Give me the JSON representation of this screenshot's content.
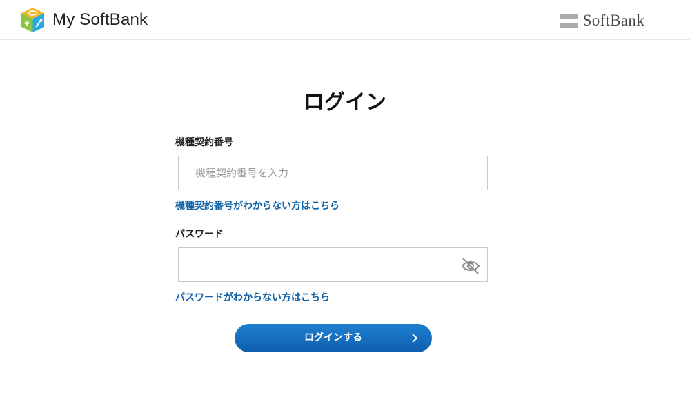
{
  "header": {
    "app_name": "My SoftBank",
    "corporate_logo_text": "SoftBank"
  },
  "login": {
    "title": "ログイン",
    "contract_number": {
      "label": "機種契約番号",
      "placeholder": "機種契約番号を入力",
      "value": "",
      "help_link": "機種契約番号がわからない方はこちら"
    },
    "password": {
      "label": "パスワード",
      "placeholder": "",
      "value": "",
      "visibility_icon": "eye-slash-icon",
      "help_link": "パスワードがわからない方はこちら"
    },
    "submit_label": "ログインする",
    "submit_icon": "chevron-right-icon"
  },
  "colors": {
    "link": "#1063a8",
    "button_top": "#1f80d0",
    "button_bottom": "#0d5fae",
    "corp_gray": "#a9abad"
  }
}
